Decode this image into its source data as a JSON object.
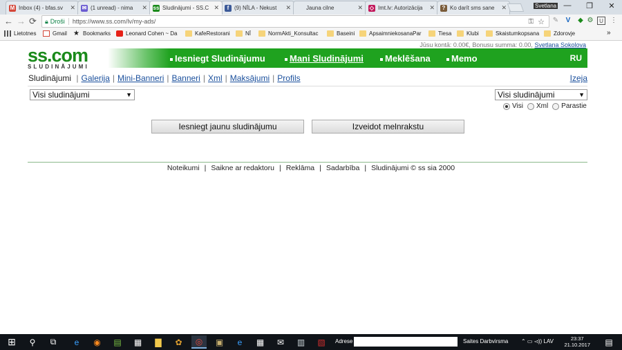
{
  "browser": {
    "tabs": [
      {
        "title": "Inbox (4) - bfas.sv",
        "favicon": "gmail-icon",
        "color": "#d44638",
        "glyph": "M"
      },
      {
        "title": "(1 unread) - nima",
        "favicon": "mail-icon",
        "color": "#6b5bd1",
        "glyph": "✉"
      },
      {
        "title": "Sludinājumi - SS.C",
        "favicon": "ss-icon",
        "color": "#1a8a1a",
        "glyph": "ss",
        "active": true
      },
      {
        "title": "(9) NĪLA - Nekust",
        "favicon": "facebook-icon",
        "color": "#3b5998",
        "glyph": "f"
      },
      {
        "title": "Jauna cilne",
        "favicon": "blank-icon",
        "color": "#e4e9ee",
        "glyph": ""
      },
      {
        "title": "Imt.lv: Autorizācija",
        "favicon": "shield-icon",
        "color": "#c2185b",
        "glyph": "◇"
      },
      {
        "title": "Ko darīt sms sane",
        "favicon": "question-icon",
        "color": "#7a5c3a",
        "glyph": "?"
      }
    ],
    "close_glyph": "✕",
    "window_user": "Svetlana",
    "window_controls": [
      "—",
      "❐",
      "✕"
    ],
    "nav": {
      "back": "←",
      "forward": "→",
      "reload": "⟳"
    },
    "secure_label": "Droši",
    "url": "https://www.ss.com/lv/my-ads/",
    "omni_icons": [
      "⚿",
      "☆"
    ],
    "extensions": [
      "✎",
      "V",
      "◆",
      "⚙",
      "U",
      "⋮"
    ],
    "bookmarks": [
      {
        "label": "Lietotnes",
        "icon": "apps-icon"
      },
      {
        "label": "Gmail",
        "icon": "gmail-icon"
      },
      {
        "label": "Bookmarks",
        "icon": "star-icon"
      },
      {
        "label": "Leonard Cohen ~ Da",
        "icon": "youtube-icon"
      },
      {
        "label": "KafeRestorani",
        "icon": "folder-icon"
      },
      {
        "label": "NĪ",
        "icon": "folder-icon"
      },
      {
        "label": "NormAkti_Konsultac",
        "icon": "folder-icon"
      },
      {
        "label": "Baseini",
        "icon": "folder-icon"
      },
      {
        "label": "ApsaimniekosanaPar",
        "icon": "folder-icon"
      },
      {
        "label": "Tiesa",
        "icon": "folder-icon"
      },
      {
        "label": "Klubi",
        "icon": "folder-icon"
      },
      {
        "label": "Skaistumkopsana",
        "icon": "folder-icon"
      },
      {
        "label": "Zdorovje",
        "icon": "folder-icon"
      }
    ],
    "bookmarks_more": "»"
  },
  "site": {
    "balance_text": "Jūsu kontā: 0.00€, Bonusu summa: 0.00,",
    "user_name": "Svetlana Sokolova",
    "logo_big": "ss.com",
    "logo_small": "SLUDINĀJUMI",
    "menu": [
      {
        "label": "Iesniegt Sludinājumu",
        "current": false
      },
      {
        "label": "Mani Sludinājumi",
        "current": true
      },
      {
        "label": "Meklēšana",
        "current": false
      },
      {
        "label": "Memo",
        "current": false
      }
    ],
    "lang": "RU",
    "subnav": {
      "current": "Sludinājumi",
      "links": [
        "Galerija",
        "Mini-Banneri",
        "Banneri",
        "Xml",
        "Maksājumi",
        "Profils"
      ],
      "separator": "|"
    },
    "exit": "Izeja",
    "filter_left": "Visi sludinājumi",
    "filter_right": "Visi sludinājumi",
    "select_arrow": "▼",
    "radios": [
      {
        "label": "Visi",
        "checked": true
      },
      {
        "label": "Xml",
        "checked": false
      },
      {
        "label": "Parastie",
        "checked": false
      }
    ],
    "buttons": {
      "submit_new": "Iesniegt jaunu sludinājumu",
      "create_draft": "Izveidot melnrakstu"
    },
    "footer": [
      "Noteikumi",
      "Saikne ar redaktoru",
      "Reklāma",
      "Sadarbība",
      "Sludinājumi © ss sia 2000"
    ],
    "accent_green": "#1fa21f"
  },
  "taskbar": {
    "start": "⊞",
    "search": "⚲",
    "task_view": "⧉",
    "apps": [
      "e",
      "◉",
      "▤",
      "▦",
      "▇",
      "✿",
      "◎",
      "▣",
      "e",
      "▦",
      "✉",
      "▥",
      "▧"
    ],
    "address_label": "Adrese",
    "tray_text": "Saites  Darbvirsma",
    "tray_icons": "⌃ ▭ ◅)) LAV",
    "time": "23:37",
    "date": "21.10.2017",
    "notify": "▤"
  }
}
